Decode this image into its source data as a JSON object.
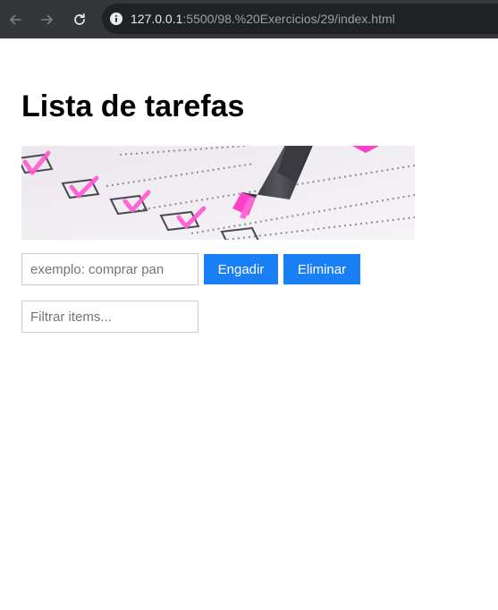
{
  "browser": {
    "url_host": "127.0.0.1",
    "url_rest": ":5500/98.%20Exercicios/29/index.html"
  },
  "page": {
    "title": "Lista de tarefas",
    "task_input_placeholder": "exemplo: comprar pan",
    "add_button_label": "Engadir",
    "remove_button_label": "Eliminar",
    "filter_input_placeholder": "Filtrar items..."
  },
  "colors": {
    "chrome_bg": "#35363a",
    "omnibox_bg": "#202124",
    "button_bg": "#1a7ef5",
    "input_border": "#cccccc",
    "highlighter_pink": "#ff3fc8"
  },
  "icons": [
    "back-arrow-icon",
    "forward-arrow-icon",
    "reload-icon",
    "site-info-icon",
    "checklist-highlighter-image"
  ]
}
